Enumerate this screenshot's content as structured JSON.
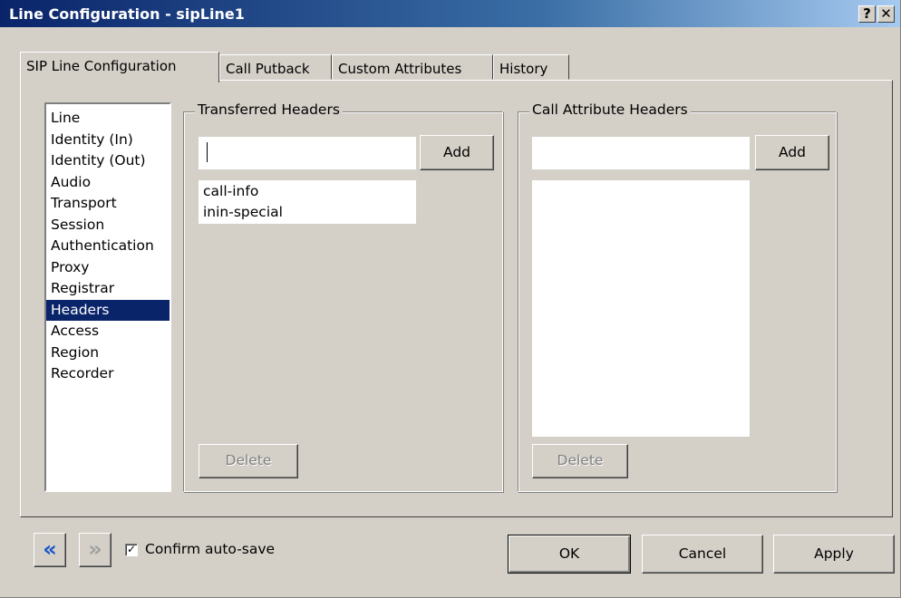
{
  "window": {
    "title": "Line Configuration - sipLine1",
    "help_glyph": "?",
    "close_glyph": "✕"
  },
  "tabs": [
    {
      "label": "SIP Line Configuration",
      "active": true
    },
    {
      "label": "Call Putback",
      "active": false
    },
    {
      "label": "Custom Attributes",
      "active": false
    },
    {
      "label": "History",
      "active": false
    }
  ],
  "nav": {
    "items": [
      "Line",
      "Identity (In)",
      "Identity (Out)",
      "Audio",
      "Transport",
      "Session",
      "Authentication",
      "Proxy",
      "Registrar",
      "Headers",
      "Access",
      "Region",
      "Recorder"
    ],
    "selected": "Headers"
  },
  "transferred": {
    "legend": "Transferred Headers",
    "input_value": "",
    "add_label": "Add",
    "items": [
      "call-info",
      "inin-special"
    ],
    "delete_label": "Delete"
  },
  "call_attribute": {
    "legend": "Call Attribute Headers",
    "input_value": "",
    "add_label": "Add",
    "items": [],
    "delete_label": "Delete"
  },
  "footer": {
    "back_glyph": "«",
    "forward_glyph": "»",
    "confirm_label": "Confirm auto-save",
    "confirm_checked": true,
    "check_glyph": "✓",
    "ok_label": "OK",
    "cancel_label": "Cancel",
    "apply_label": "Apply"
  },
  "colors": {
    "titlebar_start": "#0a246a",
    "selection": "#0a246a",
    "face": "#d4d0c8",
    "arrow_active": "#1a56c8",
    "arrow_disabled": "#a0a0a0"
  },
  "icons": {
    "back": "double-chevron-left-icon",
    "forward": "double-chevron-right-icon",
    "help": "help-icon",
    "close": "close-icon"
  }
}
